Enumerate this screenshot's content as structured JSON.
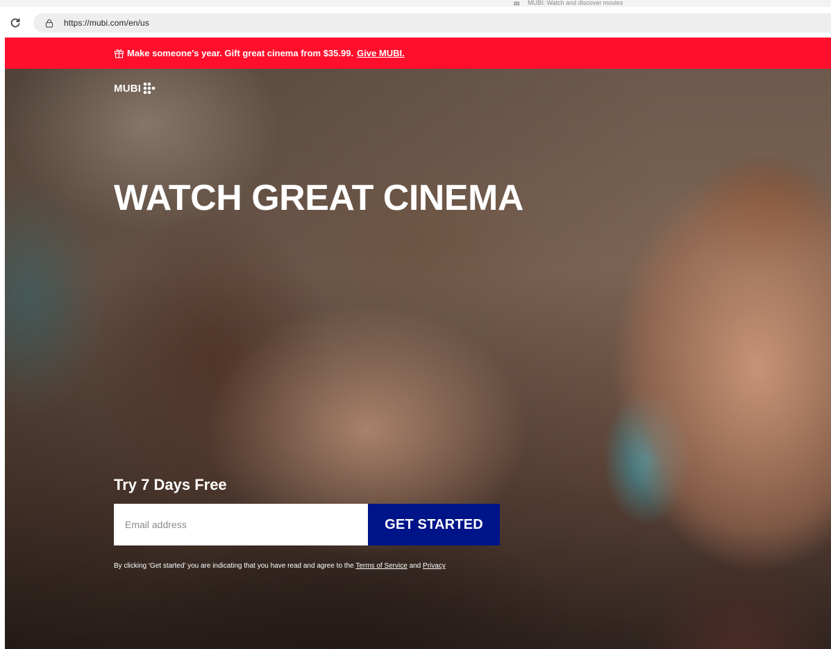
{
  "browser": {
    "tab_hint_text": "MUBI: Watch and discover movies",
    "url": "https://mubi.com/en/us",
    "icons": {
      "reload": "reload-icon",
      "site_info": "site-info-icon"
    }
  },
  "promo": {
    "icon": "gift-icon",
    "text": "Make someone's year. Gift great cinema from $35.99.",
    "link_label": "Give MUBI.",
    "background_color": "#ff0f2c"
  },
  "header": {
    "logo_text": "MUBI",
    "logo_icon": "mubi-dots-icon"
  },
  "hero": {
    "headline": "WATCH GREAT CINEMA",
    "trial_title": "Try 7 Days Free",
    "email_placeholder": "Email address",
    "cta_label": "GET STARTED",
    "cta_color": "#001489",
    "legal_text": "By clicking 'Get started' you are indicating that you have read and agree to the",
    "legal_terms": "Terms of Service",
    "legal_and": "and",
    "legal_privacy": "Privacy"
  }
}
